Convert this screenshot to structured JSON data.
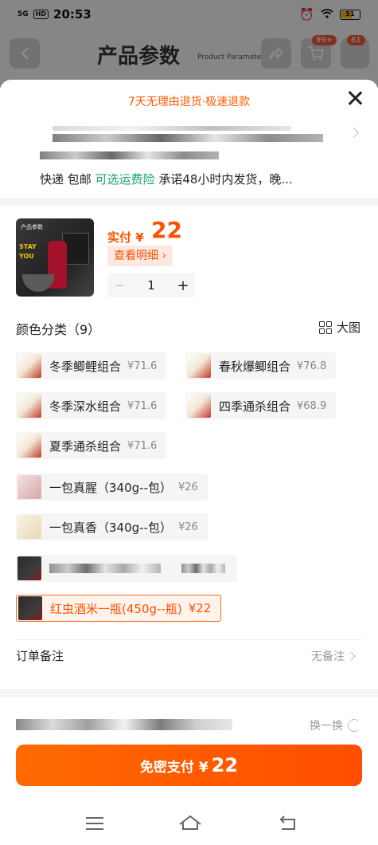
{
  "status_bar": {
    "network": "5G",
    "hd": "HD",
    "time": "20:53",
    "battery": "51"
  },
  "background_page": {
    "title": "产品参数",
    "subtitle": "Product Parameters",
    "cart_badge": "99+",
    "msg_badge": "61"
  },
  "sheet": {
    "promo": "7天无理由退货·极速退款",
    "shipping": {
      "prefix": "快递 包邮 ",
      "insurance": "可选运费险",
      "suffix": " 承诺48小时内发货，晚..."
    },
    "product": {
      "pay_label": "实付 ¥",
      "pay_amount": "22",
      "detail_button": "查看明细 ›",
      "quantity": "1",
      "minus": "−",
      "plus": "+",
      "image_caption": "产品参数",
      "image_text": "STAY YOU"
    },
    "category": {
      "title": "颜色分类（9）",
      "big_image": "大图"
    },
    "options": [
      {
        "label": "冬季鲫鲤组合",
        "price": "¥71.6"
      },
      {
        "label": "春秋爆鲫组合",
        "price": "¥76.8"
      },
      {
        "label": "冬季深水组合",
        "price": "¥71.6"
      },
      {
        "label": "四季通杀组合",
        "price": "¥68.9"
      },
      {
        "label": "夏季通杀组合",
        "price": "¥71.6"
      },
      {
        "label": "一包真腥（340g--包）",
        "price": "¥26"
      },
      {
        "label": "一包真香（340g--包）",
        "price": "¥26"
      },
      {
        "label": "",
        "price": ""
      },
      {
        "label": "红虫酒米一瓶(450g--瓶)",
        "price": "¥22"
      }
    ],
    "selected_index": 8,
    "note": {
      "label": "订单备注",
      "value": "无备注"
    },
    "switch": "换一换",
    "pay_button": {
      "label": "免密支付 ¥",
      "amount": "22"
    }
  },
  "colors": {
    "accent": "#ff5000",
    "green": "#18a46b"
  }
}
